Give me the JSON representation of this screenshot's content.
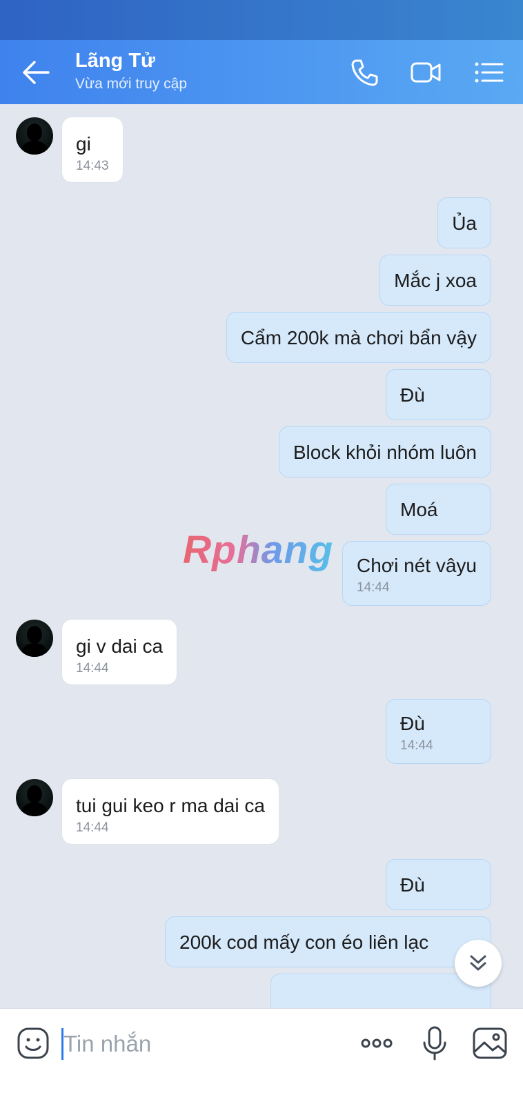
{
  "header": {
    "title": "Lãng Tử",
    "subtitle": "Vừa mới truy cập",
    "icons": [
      "back-arrow-icon",
      "phone-icon",
      "video-camera-icon",
      "menu-list-icon"
    ]
  },
  "messages": [
    {
      "dir": "in",
      "text": "gi",
      "time": "14:43"
    },
    {
      "dir": "out",
      "text": "Ủa"
    },
    {
      "dir": "out",
      "text": "Mắc j xoa"
    },
    {
      "dir": "out",
      "text": "Cẩm 200k mà chơi bẩn vậy"
    },
    {
      "dir": "out",
      "text": "Đù"
    },
    {
      "dir": "out",
      "text": "Block khỏi nhóm luôn"
    },
    {
      "dir": "out",
      "text": "Moá"
    },
    {
      "dir": "out",
      "text": "Chơi nét vâyu",
      "time": "14:44"
    },
    {
      "dir": "in",
      "text": "gi v dai ca",
      "time": "14:44"
    },
    {
      "dir": "out",
      "text": "Đù",
      "time": "14:44"
    },
    {
      "dir": "in",
      "text": "tui gui keo r ma dai ca",
      "time": "14:44"
    },
    {
      "dir": "out",
      "text": "Đù"
    },
    {
      "dir": "out",
      "text": "200k cod mấy con éo liên lạc"
    }
  ],
  "watermark": "Rphang",
  "composer": {
    "placeholder": "Tin nhắn",
    "icons": [
      "emoji-icon",
      "more-icon",
      "microphone-icon",
      "image-icon"
    ]
  },
  "colors": {
    "header_start": "#3f82ee",
    "header_end": "#5aa9f3",
    "outgoing_bubble": "#d6e9fb",
    "incoming_bubble": "#ffffff",
    "chat_background": "#e2e7ef"
  }
}
